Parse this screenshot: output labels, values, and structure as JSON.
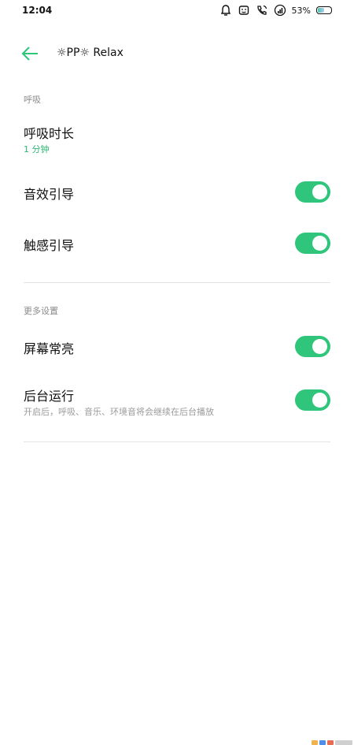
{
  "status_bar": {
    "time": "12:04",
    "icons": [
      "alarm-icon",
      "face-icon",
      "wifi-call-icon",
      "signal-icon"
    ],
    "battery_percent": "53%",
    "battery_level": 0.53
  },
  "header": {
    "back_icon": "arrow-left-icon",
    "title": "☼PP☼ Relax"
  },
  "sections": {
    "breathing_label": "呼吸",
    "more_label": "更多设置"
  },
  "settings": {
    "breath_duration": {
      "label": "呼吸时长",
      "value": "1 分钟"
    },
    "sound_guide": {
      "label": "音效引导",
      "enabled": true
    },
    "haptic_guide": {
      "label": "触感引导",
      "enabled": true
    },
    "screen_on": {
      "label": "屏幕常亮",
      "enabled": true
    },
    "background_run": {
      "label": "后台运行",
      "description": "开启后，呼吸、音乐、环境音将会继续在后台播放",
      "enabled": true
    }
  },
  "colors": {
    "accent": "#2fc57a",
    "accent_text": "#2bb673",
    "divider": "#e3e3e3",
    "muted_text": "#8a8a8a"
  }
}
